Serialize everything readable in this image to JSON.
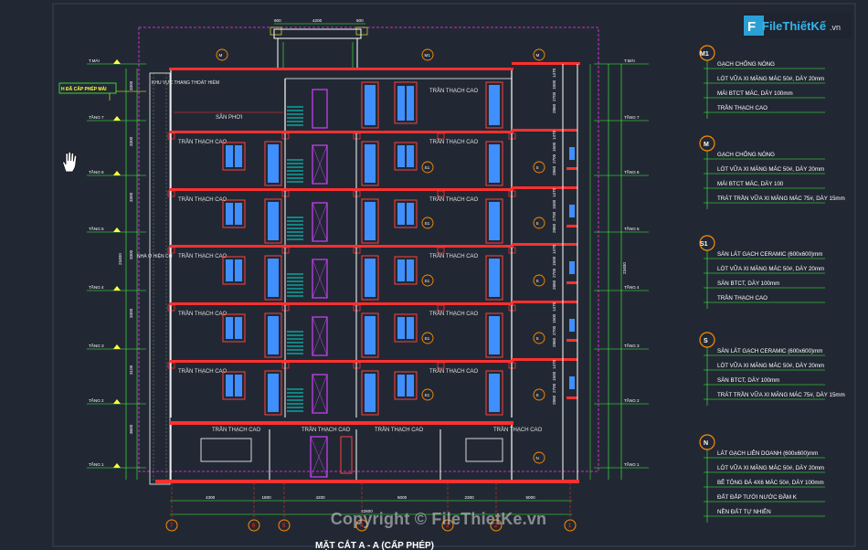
{
  "logo": {
    "brand": "FileThiếtKế",
    "tld": ".vn"
  },
  "watermark": "Copyright © FileThietKe.vn",
  "caption": "MẶT CẮT A - A (CẤP PHÉP)",
  "drawing": {
    "floor_tags": [
      "T.MÁI",
      "TẦNG 7",
      "TẦNG 6",
      "TẦNG 5",
      "TẦNG 4",
      "TẦNG 3",
      "TẦNG 2",
      "TẦNG 1"
    ],
    "floor_heights": [
      "3300",
      "3300",
      "3300",
      "3300",
      "3300",
      "3100",
      "3600"
    ],
    "height_permit_label": "H ĐÃ CẤP PHÉP MÁI",
    "total_height": "23400",
    "roof_room_label": "KHU VỰC THANG THOÁT HIỂM",
    "drying_yard": "SÂN PHƠI",
    "stair_label": "NHÀ Ở HIỆN CÓ",
    "ceiling_label": "TRẦN THẠCH CAO",
    "top_dims": [
      "600",
      "4200",
      "600"
    ],
    "bottom_dims": [
      "4300",
      "1800",
      "4200",
      "5000",
      "2300",
      "5000"
    ],
    "bottom_total": "22600",
    "right_dims": [
      "1470",
      "1500",
      "2700",
      "2860"
    ],
    "axes": [
      "7",
      "6",
      "5",
      "4",
      "3",
      "2",
      "1"
    ],
    "section_marks": [
      "M1",
      "M",
      "S1",
      "S",
      "N"
    ]
  },
  "notes": [
    {
      "tag": "M1",
      "lines": [
        "GẠCH CHỐNG NÓNG",
        "LÓT VỮA XI MĂNG MÁC 50#, DÀY 20mm",
        "MÁI BTCT MÁC, DÀY 100mm",
        "TRẦN THẠCH CAO"
      ]
    },
    {
      "tag": "M",
      "lines": [
        "GẠCH CHỐNG NÓNG",
        "LÓT VỮA XI MĂNG MÁC 50#, DÀY 20mm",
        "MÁI BTCT MÁC, DÀY 100",
        "TRÁT TRẦN VỮA XI MĂNG MÁC 75#, DÀY 15mm"
      ]
    },
    {
      "tag": "S1",
      "lines": [
        "SÀN LÁT GẠCH CERAMIC (600x600)mm",
        "LÓT VỮA XI MĂNG MÁC 50#, DÀY 20mm",
        "SÀN BTCT, DÀY 100mm",
        "TRẦN THẠCH CAO"
      ]
    },
    {
      "tag": "S",
      "lines": [
        "SÀN LÁT GẠCH CERAMIC (600x600)mm",
        "LÓT VỮA XI MĂNG MÁC 50#, DÀY 20mm",
        "SÀN BTCT, DÀY 100mm",
        "TRÁT TRẦN VỮA XI MĂNG MÁC 75#, DÀY 15mm"
      ]
    },
    {
      "tag": "N",
      "lines": [
        "LÁT GẠCH LIÊN DOANH (600x600)mm",
        "LÓT VỮA XI MĂNG MÁC 50#, DÀY 20mm",
        "BÊ TÔNG ĐÁ 4X6 MÁC 50#, DÀY 100mm",
        "ĐẤT ĐẮP TƯỚI NƯỚC ĐẦM K",
        "NỀN ĐẤT TỰ NHIÊN"
      ]
    }
  ],
  "colors": {
    "bg": "#222833",
    "slab": "#ff3030",
    "note_line": "#3cff3c",
    "wall": "#ffffff",
    "window": "#3f8fff",
    "door": "#d040ff",
    "stair": "#00e0d0",
    "tag_circle": "#ff8c00",
    "frame": "#ff2fff"
  }
}
